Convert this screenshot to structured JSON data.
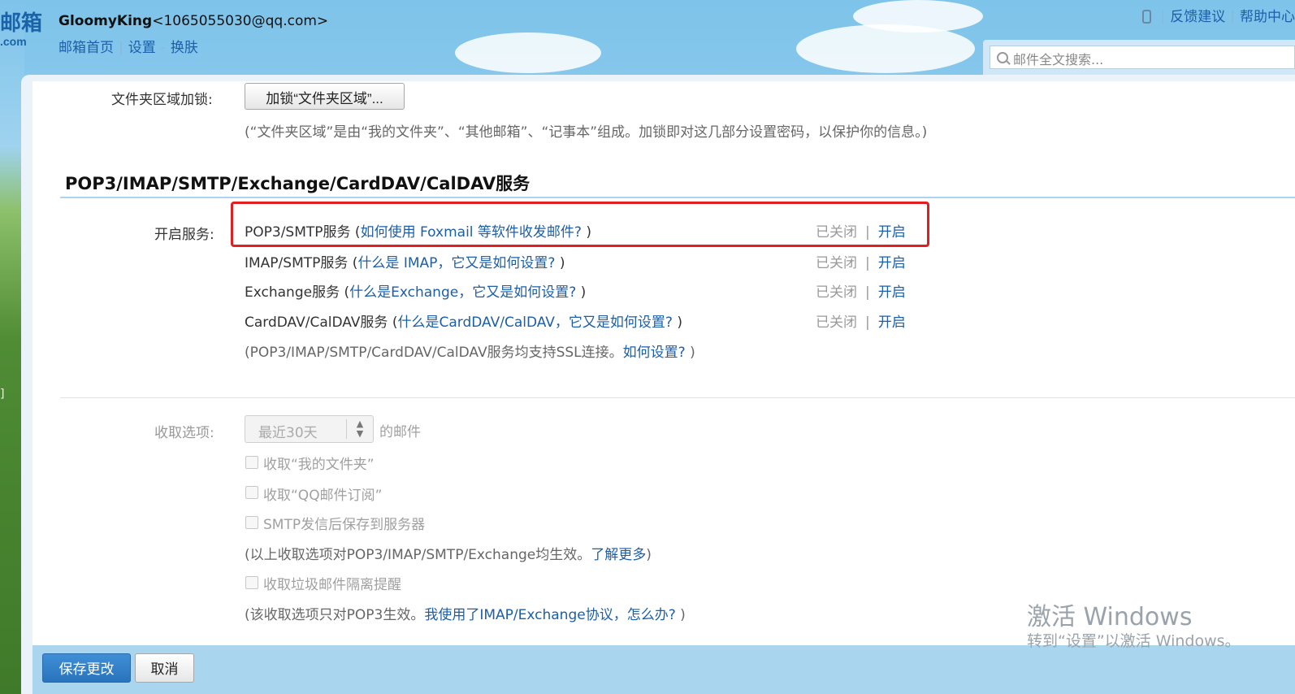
{
  "header": {
    "logo_text": "邮箱",
    "logo_sub": ".com",
    "account_name": "GloomyKing",
    "account_email": "<1065055030@qq.com>",
    "nav": {
      "home": "邮箱首页",
      "settings": "设置",
      "skin": "换肤"
    },
    "nav_sep_pipe": "|",
    "nav_sep_dash": "-",
    "topright": {
      "feedback": "反馈建议",
      "help": "帮助中心",
      "sep": "|"
    },
    "search_placeholder": "邮件全文搜索...",
    "side_bracket": "]"
  },
  "folder_lock": {
    "label": "文件夹区域加锁:",
    "button": "加锁“文件夹区域”...",
    "note": "(“文件夹区域”是由“我的文件夹”、“其他邮箱”、“记事本”组成。加锁即对这几部分设置密码，以保护你的信息。)"
  },
  "services": {
    "title": "POP3/IMAP/SMTP/Exchange/CardDAV/CalDAV服务",
    "label": "开启服务:",
    "items": [
      {
        "name": "POP3/SMTP服务",
        "open_paren": " (",
        "link": "如何使用 Foxmail 等软件收发邮件?",
        "close_paren": " )",
        "status": "已关闭",
        "action": "开启"
      },
      {
        "name": "IMAP/SMTP服务",
        "open_paren": " (",
        "link": "什么是 IMAP，它又是如何设置?",
        "close_paren": " )",
        "status": "已关闭",
        "action": "开启"
      },
      {
        "name": "Exchange服务",
        "open_paren": " (",
        "link": "什么是Exchange，它又是如何设置?",
        "close_paren": " )",
        "status": "已关闭",
        "action": "开启"
      },
      {
        "name": "CardDAV/CalDAV服务",
        "open_paren": " (",
        "link": "什么是CardDAV/CalDAV，它又是如何设置?",
        "close_paren": " )",
        "status": "已关闭",
        "action": "开启"
      }
    ],
    "pipe": "|",
    "ssl_note": "(POP3/IMAP/SMTP/CardDAV/CalDAV服务均支持SSL连接。",
    "ssl_link": "如何设置?",
    "ssl_close": " )"
  },
  "receive": {
    "label": "收取选项:",
    "select_value": "最近30天",
    "suffix": "的邮件",
    "options": [
      "收取“我的文件夹”",
      "收取“QQ邮件订阅”",
      "SMTP发信后保存到服务器"
    ],
    "note1": "(以上收取选项对POP3/IMAP/SMTP/Exchange均生效。",
    "note1_link": "了解更多",
    "note1_close": ")",
    "spam_option": "收取垃圾邮件隔离提醒",
    "note2": "(该收取选项只对POP3生效。",
    "note2_link": "我使用了IMAP/Exchange协议，怎么办?",
    "note2_close": " )"
  },
  "footer": {
    "save": "保存更改",
    "cancel": "取消"
  },
  "watermark": {
    "line1": "激活 Windows",
    "line2": "转到“设置”以激活 Windows。"
  },
  "colors": {
    "accent": "#1c5fa8",
    "highlight": "#e02020",
    "panel": "#a9d5ee"
  }
}
